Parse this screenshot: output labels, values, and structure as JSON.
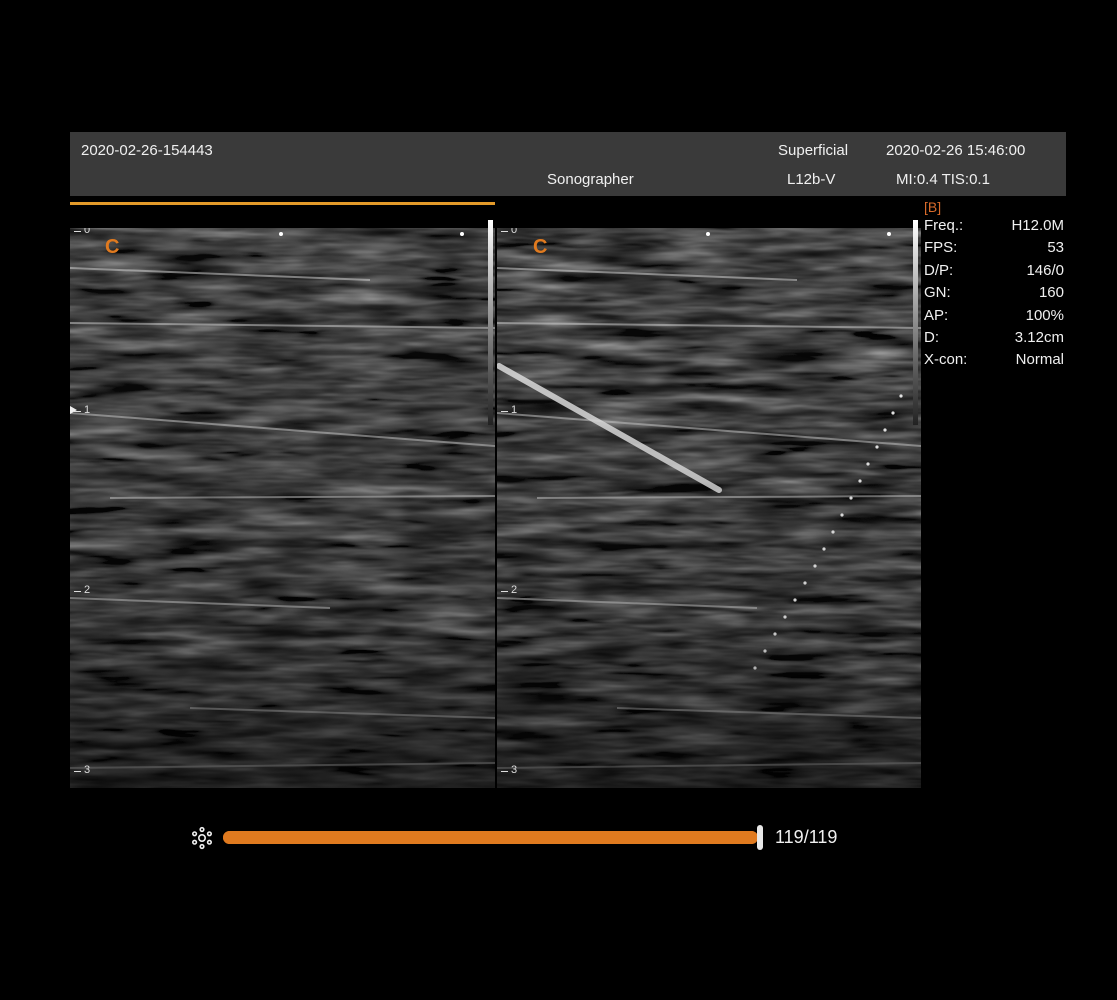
{
  "header": {
    "study_id": "2020-02-26-154443",
    "preset": "Superficial",
    "datetime": "2020-02-26 15:46:00",
    "operator": "Sonographer",
    "probe": "L12b-V",
    "indices": "MI:0.4 TIS:0.1"
  },
  "images": {
    "left": {
      "mode_letter": "C",
      "depth_ticks": [
        "0",
        "1",
        "2",
        "3"
      ]
    },
    "right": {
      "mode_letter": "C",
      "depth_ticks": [
        "0",
        "1",
        "2",
        "3"
      ]
    }
  },
  "params": {
    "mode": "[B]",
    "rows": [
      {
        "label": "Freq.:",
        "value": "H12.0M"
      },
      {
        "label": "FPS:",
        "value": "53"
      },
      {
        "label": "D/P:",
        "value": "146/0"
      },
      {
        "label": "GN:",
        "value": "160"
      },
      {
        "label": "AP:",
        "value": "100%"
      },
      {
        "label": "D:",
        "value": "3.12cm"
      },
      {
        "label": "X-con:",
        "value": "Normal"
      }
    ]
  },
  "cine": {
    "frame_label": "119/119",
    "current_frame": 119,
    "total_frames": 119,
    "icon": "gear-icon"
  },
  "colors": {
    "accent": "#e07a1f",
    "header_bg": "#3a3a3a",
    "mode_label": "#d86a2a"
  }
}
